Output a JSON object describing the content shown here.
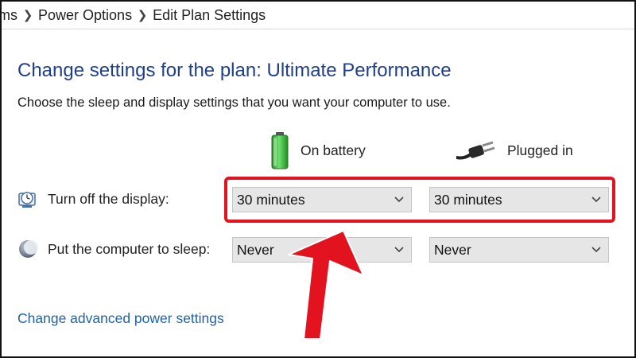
{
  "breadcrumb": {
    "items": [
      "ems",
      "Power Options",
      "Edit Plan Settings"
    ]
  },
  "page": {
    "title": "Change settings for the plan: Ultimate Performance",
    "subtitle": "Choose the sleep and display settings that you want your computer to use."
  },
  "columns": {
    "battery_label": "On battery",
    "plugged_label": "Plugged in"
  },
  "rows": {
    "display": {
      "label": "Turn off the display:",
      "battery_value": "30 minutes",
      "plugged_value": "30 minutes"
    },
    "sleep": {
      "label": "Put the computer to sleep:",
      "battery_value": "Never",
      "plugged_value": "Never"
    }
  },
  "links": {
    "advanced": "Change advanced power settings"
  },
  "colors": {
    "title": "#1f3f8a",
    "link": "#1f62a8",
    "highlight": "#e3121f",
    "dropdown_bg": "#e6e6e6"
  },
  "icons": {
    "battery": "battery-icon",
    "plug": "plug-icon",
    "display": "display-clock-icon",
    "sleep": "moon-icon",
    "dropdown": "chevron-down-icon",
    "annotation": "red-arrow-annotation"
  }
}
